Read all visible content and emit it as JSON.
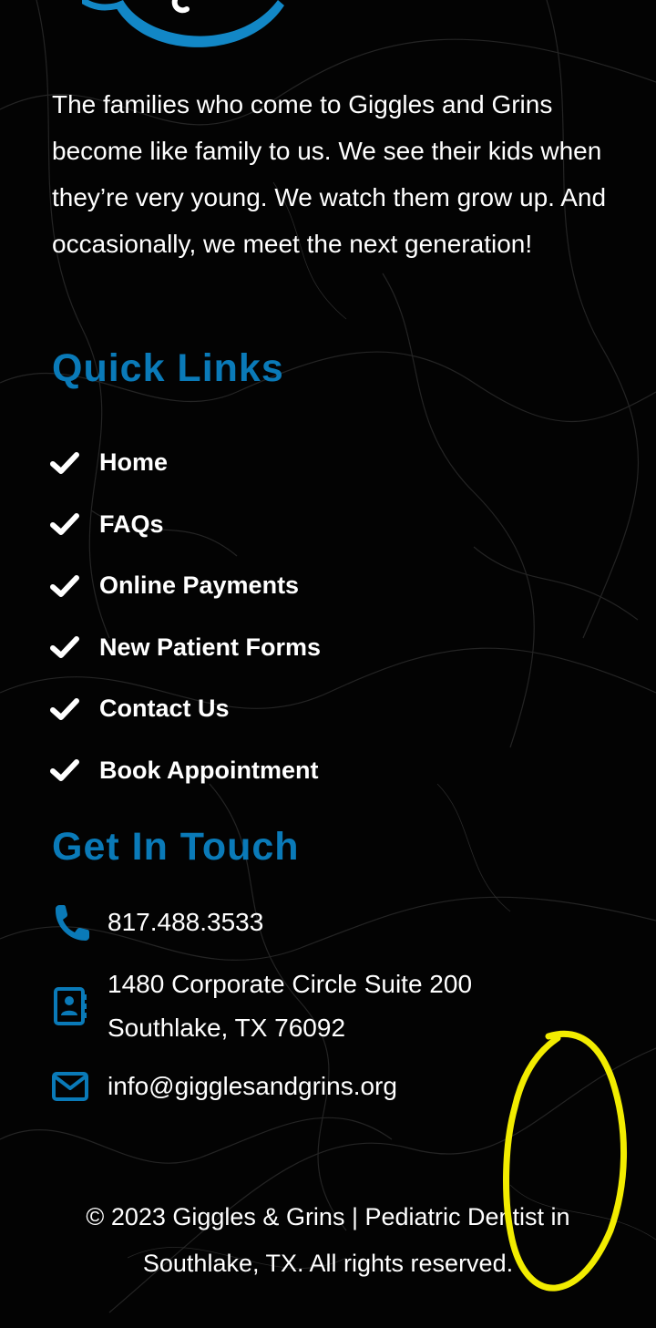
{
  "intro_text": "The families who come to Giggles and Grins become like family to us. We see their kids when they’re very young. We watch them grow up. And occasionally, we meet the next generation!",
  "quick_links": {
    "heading": "Quick Links",
    "items": [
      {
        "label": "Home",
        "icon": "check-icon"
      },
      {
        "label": "FAQs",
        "icon": "check-icon"
      },
      {
        "label": "Online Payments",
        "icon": "check-icon"
      },
      {
        "label": "New Patient Forms",
        "icon": "check-icon"
      },
      {
        "label": "Contact Us",
        "icon": "check-icon"
      },
      {
        "label": "Book Appointment",
        "icon": "check-icon"
      }
    ]
  },
  "contact": {
    "heading": "Get In Touch",
    "phone": "817.488.3533",
    "address_line1": "1480 Corporate Circle Suite 200",
    "address_line2": "Southlake, TX 76092",
    "email": "info@gigglesandgrins.org",
    "icons": [
      "phone-icon",
      "address-book-icon",
      "envelope-icon"
    ]
  },
  "footer": {
    "copyright": "© 2023 Giggles & Grins | Pediatric Dentist in Southlake, TX. All rights reserved."
  },
  "colors": {
    "background": "#030303",
    "accent": "#0a7ab8",
    "text": "#ffffff",
    "annotation": "#f2ec00"
  }
}
